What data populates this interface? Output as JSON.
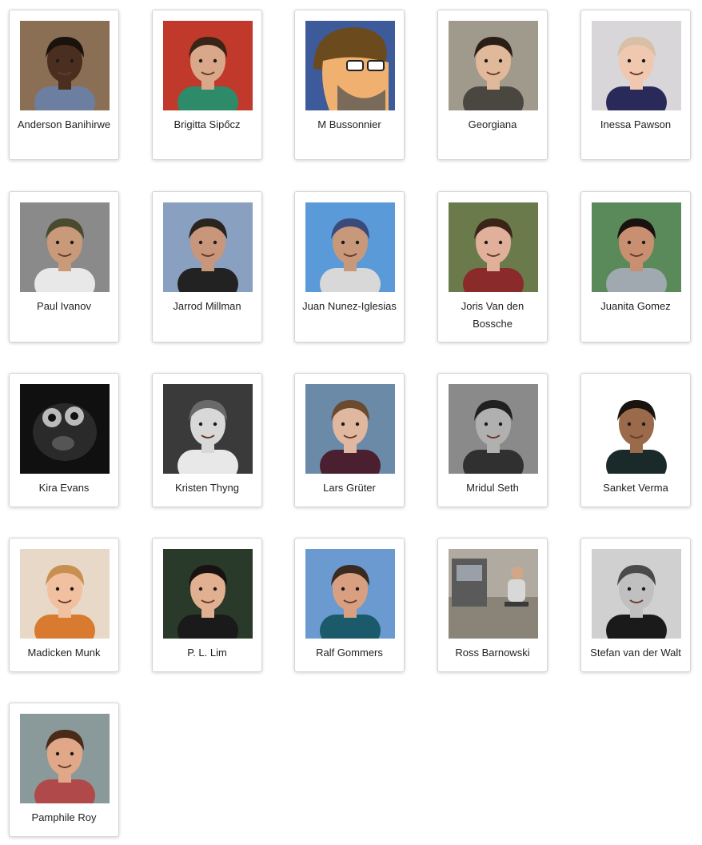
{
  "team": {
    "members": [
      {
        "name": "Anderson Banihirwe",
        "photo": "portrait-photo",
        "bg": "#8a6f55",
        "skin": "#4a2e1f",
        "hair": "#1a120c",
        "shirt": "#6d7fa0"
      },
      {
        "name": "Brigitta Sipőcz",
        "photo": "portrait-photo",
        "bg": "#c0392b",
        "skin": "#d9a88a",
        "hair": "#3a2418",
        "shirt": "#2e8b6a"
      },
      {
        "name": "M Bussonnier",
        "photo": "cartoon-avatar",
        "bg": "#3d5a9a",
        "skin": "#f0b070",
        "hair": "#6b4a1e",
        "shirt": "#c8a060"
      },
      {
        "name": "Georgiana",
        "photo": "portrait-photo",
        "bg": "#a09a8c",
        "skin": "#e0b89a",
        "hair": "#2a1e16",
        "shirt": "#4a4640"
      },
      {
        "name": "Inessa Pawson",
        "photo": "portrait-photo",
        "bg": "#d8d6d8",
        "skin": "#f0c8b0",
        "hair": "#d8c0a8",
        "shirt": "#2a2a5a"
      },
      {
        "name": "Paul Ivanov",
        "photo": "portrait-photo",
        "bg": "#8a8a8a",
        "skin": "#c89a7a",
        "hair": "#4a4a30",
        "shirt": "#e8e8e8"
      },
      {
        "name": "Jarrod Millman",
        "photo": "portrait-photo",
        "bg": "#8aa0c0",
        "skin": "#c8967a",
        "hair": "#2a2420",
        "shirt": "#222222"
      },
      {
        "name": "Juan Nunez-Iglesias",
        "photo": "portrait-photo",
        "bg": "#5a9ad8",
        "skin": "#c8987a",
        "hair": "#3a4a7a",
        "shirt": "#d8d8d8"
      },
      {
        "name": "Joris Van den Bossche",
        "photo": "portrait-photo",
        "bg": "#6a7a4a",
        "skin": "#e0b09a",
        "hair": "#3a2418",
        "shirt": "#8a2a2a"
      },
      {
        "name": "Juanita Gomez",
        "photo": "portrait-photo",
        "bg": "#5a8a5a",
        "skin": "#c89070",
        "hair": "#1a1210",
        "shirt": "#a0a8b0"
      },
      {
        "name": "Kira Evans",
        "photo": "cell-image",
        "bg": "#101010",
        "skin": "#c8c8c8",
        "hair": "#606060",
        "shirt": "#303030"
      },
      {
        "name": "Kristen Thyng",
        "photo": "portrait-photo",
        "bg": "#3a3a3a",
        "skin": "#d8d8d8",
        "hair": "#6a6a6a",
        "shirt": "#e8e8e8"
      },
      {
        "name": "Lars Grüter",
        "photo": "portrait-photo",
        "bg": "#6a8aa8",
        "skin": "#e0b8a0",
        "hair": "#6a4a30",
        "shirt": "#4a2030"
      },
      {
        "name": "Mridul Seth",
        "photo": "portrait-photo",
        "bg": "#8a8a8a",
        "skin": "#b0b0b0",
        "hair": "#202020",
        "shirt": "#303030"
      },
      {
        "name": "Sanket Verma",
        "photo": "portrait-photo",
        "bg": "#ffffff",
        "skin": "#9a6a4a",
        "hair": "#1a1410",
        "shirt": "#1a2a2a"
      },
      {
        "name": "Madicken Munk",
        "photo": "portrait-photo",
        "bg": "#e8d8c8",
        "skin": "#f0c0a0",
        "hair": "#c89050",
        "shirt": "#d87a30"
      },
      {
        "name": "P. L. Lim",
        "photo": "portrait-photo",
        "bg": "#2a3a2a",
        "skin": "#e0b090",
        "hair": "#1a1210",
        "shirt": "#1a1a1a"
      },
      {
        "name": "Ralf Gommers",
        "photo": "portrait-photo",
        "bg": "#6a9ad0",
        "skin": "#d8a080",
        "hair": "#3a2a20",
        "shirt": "#1a5a6a"
      },
      {
        "name": "Ross Barnowski",
        "photo": "lab-photo",
        "bg": "#b0aaa0",
        "skin": "#d0a888",
        "hair": "#4a3a2a",
        "shirt": "#d8d8d8"
      },
      {
        "name": "Stefan van der Walt",
        "photo": "portrait-photo",
        "bg": "#d0d0d0",
        "skin": "#c0c0c0",
        "hair": "#4a4a4a",
        "shirt": "#1a1a1a"
      },
      {
        "name": "Pamphile Roy",
        "photo": "portrait-photo",
        "bg": "#8a9a9a",
        "skin": "#e0a888",
        "hair": "#4a2a18",
        "shirt": "#b04a4a"
      }
    ]
  }
}
